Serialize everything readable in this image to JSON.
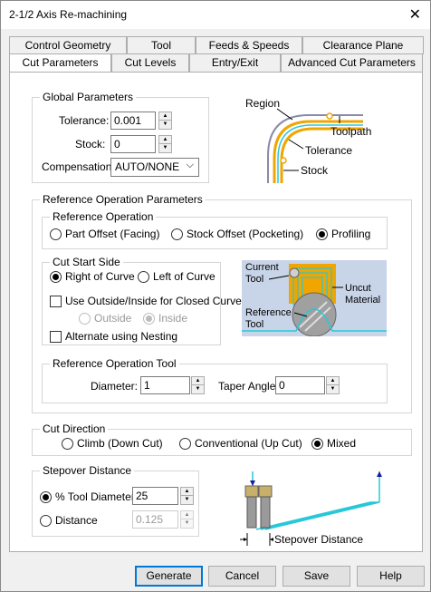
{
  "window": {
    "title": "2-1/2 Axis Re-machining",
    "close_glyph": "✕"
  },
  "tabs_back": [
    "Control Geometry",
    "Tool",
    "Feeds & Speeds",
    "Clearance Plane"
  ],
  "tabs_front": [
    "Cut Parameters",
    "Cut Levels",
    "Entry/Exit",
    "Advanced Cut Parameters"
  ],
  "global": {
    "title": "Global Parameters",
    "tolerance_label": "Tolerance:",
    "tolerance_value": "0.001",
    "stock_label": "Stock:",
    "stock_value": "0",
    "compensation_label": "Compensation:",
    "compensation_value": "AUTO/NONE"
  },
  "diagram1": {
    "region": "Region",
    "toolpath": "Toolpath",
    "tolerance": "Tolerance",
    "stock": "Stock"
  },
  "ref_op": {
    "title": "Reference Operation Parameters",
    "sub_title": "Reference Operation",
    "part_offset": "Part Offset (Facing)",
    "stock_offset": "Stock Offset (Pocketing)",
    "profiling": "Profiling",
    "cut_start_title": "Cut Start Side",
    "right_of_curve": "Right of Curve",
    "left_of_curve": "Left of Curve",
    "use_outside_inside": "Use Outside/Inside for Closed Curves",
    "outside": "Outside",
    "inside": "Inside",
    "alternate_nesting": "Alternate using Nesting",
    "tool_title": "Reference Operation Tool",
    "diameter_label": "Diameter:",
    "diameter_value": "1",
    "taper_label": "Taper Angle:",
    "taper_value": "0"
  },
  "diagram2": {
    "current_tool_1": "Current",
    "current_tool_2": "Tool",
    "uncut_1": "Uncut",
    "uncut_2": "Material",
    "ref_tool_1": "Reference",
    "ref_tool_2": "Tool"
  },
  "cut_direction": {
    "title": "Cut Direction",
    "climb": "Climb (Down Cut)",
    "conventional": "Conventional (Up Cut)",
    "mixed": "Mixed"
  },
  "stepover": {
    "title": "Stepover Distance",
    "pct_label": "% Tool Diameter",
    "pct_value": "25",
    "distance_label": "Distance",
    "distance_value": "0.125",
    "diagram_label": "Stepover Distance"
  },
  "buttons": {
    "generate": "Generate",
    "cancel": "Cancel",
    "save": "Save",
    "help": "Help"
  },
  "colors": {
    "accent": "#0078d7",
    "region_orange": "#f0a500",
    "toolpath_cyan": "#27c8d8",
    "stock_gray": "#8a8aa8"
  }
}
